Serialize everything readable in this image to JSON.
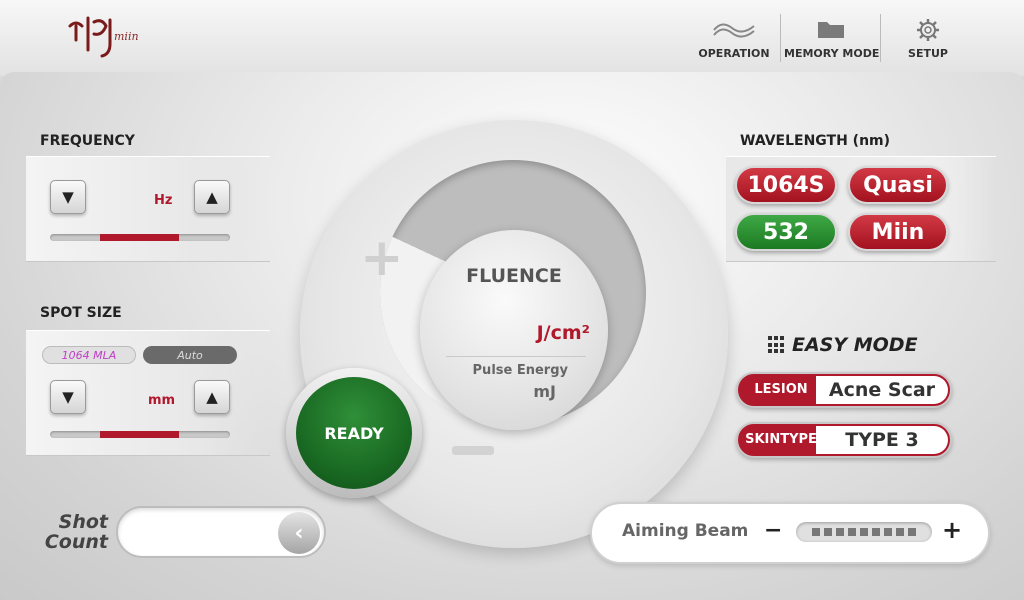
{
  "header": {
    "logo_text": "miin",
    "nav": [
      {
        "label": "OPERATION",
        "icon": "wave-icon"
      },
      {
        "label": "MEMORY MODE",
        "icon": "folder-icon"
      },
      {
        "label": "SETUP",
        "icon": "gear-icon"
      }
    ]
  },
  "frequency": {
    "title": "FREQUENCY",
    "unit": "Hz",
    "down_symbol": "▼",
    "up_symbol": "▲"
  },
  "spot_size": {
    "title": "SPOT SIZE",
    "tag_mla": "1064 MLA",
    "tag_auto": "Auto",
    "unit": "mm",
    "down_symbol": "▼",
    "up_symbol": "▲"
  },
  "shot_count": {
    "label_line1": "Shot",
    "label_line2": "Count",
    "value": "",
    "back_symbol": "‹"
  },
  "dial": {
    "plus_symbol": "+",
    "fluence_title": "FLUENCE",
    "fluence_unit": "J/cm²",
    "pulse_energy_label": "Pulse Energy",
    "pulse_energy_unit": "mJ"
  },
  "ready_button": {
    "label": "READY",
    "color": "#1a6a23"
  },
  "wavelength": {
    "title": "WAVELENGTH (nm)",
    "options": [
      {
        "label": "1064S",
        "color": "#b0182b"
      },
      {
        "label": "Quasi",
        "color": "#b0182b"
      },
      {
        "label": "532",
        "color": "#1c7a22"
      },
      {
        "label": "Miin",
        "color": "#b0182b"
      }
    ]
  },
  "easy_mode": {
    "title": "EASY MODE",
    "lesion_tag": "LESION",
    "lesion_value": "Acne Scar",
    "skin_tag_line1": "SKIN",
    "skin_tag_line2": "TYPE",
    "skin_value": "TYPE 3"
  },
  "aiming_beam": {
    "label": "Aiming Beam",
    "minus_symbol": "−",
    "plus_symbol": "+"
  },
  "colors": {
    "accent": "#b0182b",
    "ready_green": "#1a6a23"
  }
}
